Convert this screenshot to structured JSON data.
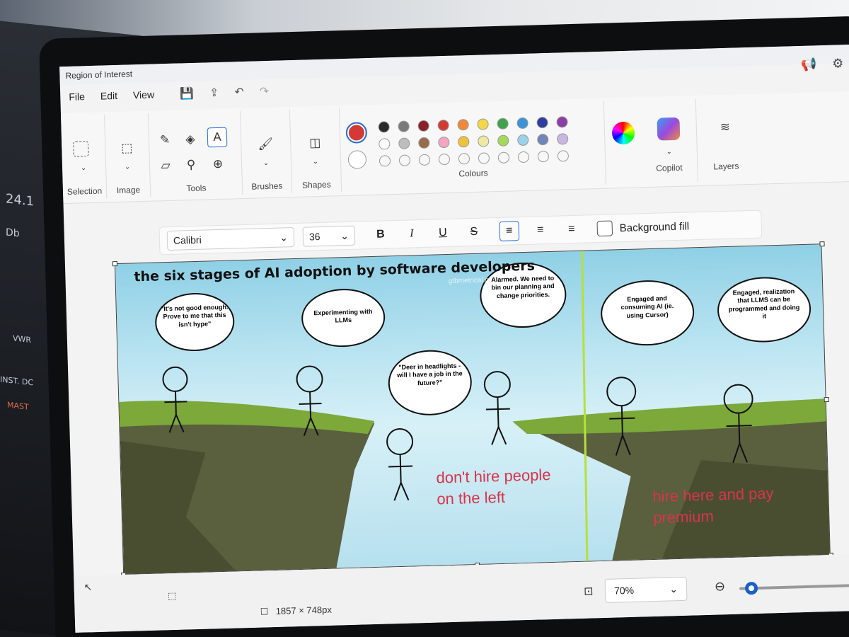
{
  "window": {
    "title": "Region of Interest"
  },
  "menu": {
    "file": "File",
    "edit": "Edit",
    "view": "View"
  },
  "ribbon": {
    "selection_label": "Selection",
    "image_label": "Image",
    "tools_label": "Tools",
    "brushes_label": "Brushes",
    "shapes_label": "Shapes",
    "colours_label": "Colours",
    "copilot_label": "Copilot",
    "layers_label": "Layers",
    "palette_row1": [
      "#2b2b2b",
      "#7a7a7a",
      "#8b1f2a",
      "#d33a36",
      "#ee8a3a",
      "#f2d848",
      "#3fa34d",
      "#3b93d8",
      "#2c3fa0",
      "#8a3fa8"
    ],
    "palette_row2": [
      "#ffffff",
      "#bdbdbd",
      "#9a6b4a",
      "#f2a6c2",
      "#f0c23a",
      "#efe7a6",
      "#a6d85a",
      "#9bd2ea",
      "#6f86b8",
      "#c8b6e2"
    ],
    "active_colour": "#d33a36"
  },
  "format": {
    "font": "Calibri",
    "size": "36",
    "bold": "B",
    "italic": "I",
    "underline": "U",
    "strike": "S",
    "background_fill": "Background fill"
  },
  "canvas": {
    "title": "the six stages of AI adoption by software developers",
    "watermark": "gtbmetrical.com",
    "bubbles": [
      "\"It's not good enough. Prove to me that this isn't hype\"",
      "Experimenting with LLMs",
      "\"Deer in headlights - will I have a job in the future?\"",
      "Alarmed. We need to bin our planning and change priorities.",
      "Engaged and consuming AI (ie. using Cursor)",
      "Engaged, realization that LLMS can be programmed and doing it"
    ],
    "left_note_line1": "don't hire people",
    "left_note_line2": "on the left",
    "right_note_line1": "hire here and pay",
    "right_note_line2": "premium"
  },
  "status": {
    "dimensions": "1857 × 748px",
    "zoom": "70%"
  },
  "background_device": {
    "label1": "24.1",
    "label2": "Db",
    "label3": "VWR",
    "label4": "INST. DC",
    "label5": "MAST"
  }
}
